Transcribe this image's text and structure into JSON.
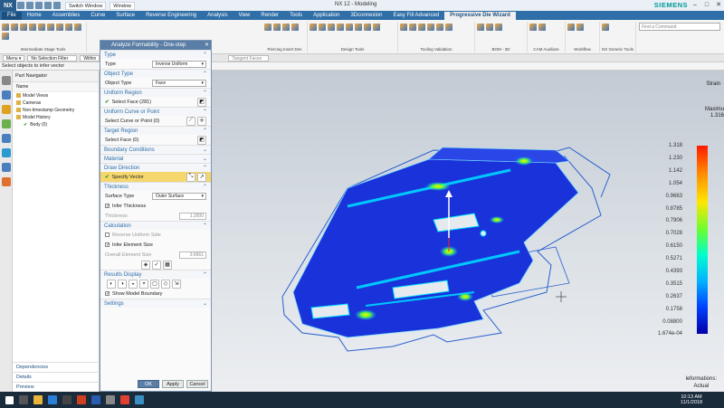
{
  "titlebar": {
    "logo": "NX",
    "switch_window": "Switch Window",
    "window": "Window",
    "title": "NX 12 - Modeling",
    "brand": "SIEMENS"
  },
  "menu": {
    "tabs": [
      "File",
      "Home",
      "Assemblies",
      "Curve",
      "Surface",
      "Reverse Engineering",
      "Analysis",
      "View",
      "Render",
      "Tools",
      "Application",
      "3Dconnexion",
      "Easy Fill Advanced",
      "Progressive Die Wizard"
    ],
    "active_index": 13
  },
  "ribbon": {
    "groups": [
      "Intermediate Stage Tools",
      "Piercing Insert Des",
      "Design Tools",
      "Tooling Validation",
      "BOM - 3D",
      "CAM Auxiliare",
      "Workflow",
      "NX Generic Tools"
    ],
    "find_placeholder": "Find a Command"
  },
  "selbar": {
    "menu": "Menu ▾",
    "filter": "No Selection Filter",
    "within": "Within",
    "tangent": "Tangent Faces"
  },
  "status": "Select objects to infer vector",
  "navigator": {
    "title": "Part Navigator",
    "col_name": "Name",
    "items": [
      "Model Views",
      "Cameras",
      "Non-timestamp Geometry",
      "Model History",
      "Body (0)"
    ],
    "bottom": [
      "Dependencies",
      "Details",
      "Preview"
    ]
  },
  "dialog": {
    "title": "Analyze Formability - One-step",
    "type": {
      "section": "Type",
      "label": "Type",
      "value": "Inverse Uniform"
    },
    "object_type": {
      "section": "Object Type",
      "label": "Object Type",
      "value": "Face"
    },
    "uniform_region": {
      "section": "Uniform Region",
      "label": "Select Face (281)"
    },
    "uniform_curve": {
      "section": "Uniform Curve or Point",
      "label": "Select Curve or Point (0)"
    },
    "target_region": {
      "section": "Target Region",
      "label": "Select Face (0)"
    },
    "boundary": "Boundary Conditions",
    "material": "Material",
    "draw_direction": {
      "section": "Draw Direction",
      "label": "Specify Vector"
    },
    "thickness": {
      "section": "Thickness",
      "surface_label": "Surface Type",
      "surface_value": "Outer Surface",
      "infer": "Infer Thickness",
      "thickness_label": "Thickness",
      "thickness_value": "1.2000"
    },
    "calculation": {
      "section": "Calculation",
      "reverse": "Reverse Uniform Side",
      "infer": "Infer Element Size",
      "elem_label": "Overall Element Size",
      "elem_value": "3.6661"
    },
    "results": {
      "section": "Results Display",
      "show_boundary": "Show Model Boundary"
    },
    "settings": "Settings",
    "buttons": {
      "ok": "OK",
      "apply": "Apply",
      "cancel": "Cancel"
    }
  },
  "graphics": {
    "strain_label": "Strain",
    "max_label": "Maximu",
    "max_value": "1.316",
    "ticks": [
      "1.318",
      "1.230",
      "1.142",
      "1.054",
      "0.9663",
      "0.8785",
      "0.7906",
      "0.7028",
      "0.6150",
      "0.5271",
      "0.4393",
      "0.3515",
      "0.2637",
      "0.1758",
      "0.08800",
      "1.674e-04"
    ],
    "legend_line1": "leformations:",
    "legend_line2": "Actual"
  },
  "taskbar": {
    "time": "10:13 AM",
    "date": "11/1/2018"
  }
}
